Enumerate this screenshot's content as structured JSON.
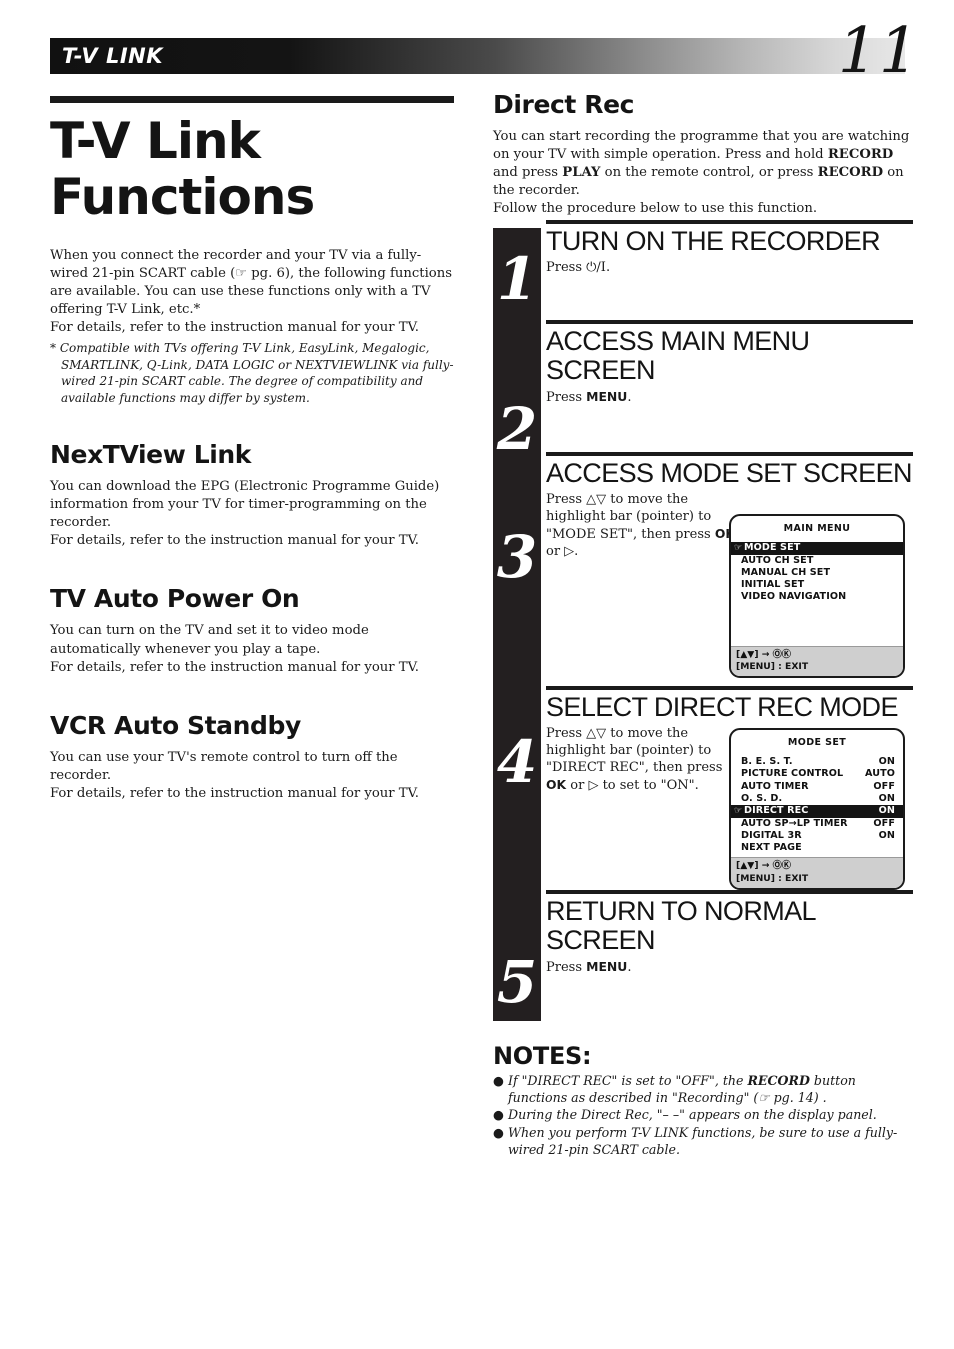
{
  "header": {
    "running_title": "T-V LINK",
    "page_number": "11"
  },
  "left_column": {
    "main_title_line1": "T-V Link",
    "main_title_line2": "Functions",
    "intro": "When you connect the recorder and your TV via a fully-wired 21-pin SCART cable (☞ pg. 6), the following functions are available. You can use these functions only with a TV offering T-V Link, etc.*",
    "intro_details": "For details, refer to the instruction manual for your TV.",
    "footnote": "* Compatible with TVs offering T-V Link, EasyLink, Megalogic, SMARTLINK, Q-Link, DATA LOGIC or NEXTVIEWLINK via fully-wired 21-pin SCART cable. The degree of compatibility and available functions may differ by system.",
    "sections": [
      {
        "heading": "NexTView Link",
        "body": "You can download the EPG (Electronic Programme Guide) information from your TV for timer-programming on the recorder.",
        "details": "For details, refer to the instruction manual for your TV."
      },
      {
        "heading": "TV Auto Power On",
        "body": "You can turn on the TV and set it to video mode automatically whenever you play a tape.",
        "details": "For details, refer to the instruction manual for your TV."
      },
      {
        "heading": "VCR Auto Standby",
        "body": "You can use your TV's remote control to turn off the recorder.",
        "details": "For details, refer to the instruction manual for your TV."
      }
    ]
  },
  "right_column": {
    "heading": "Direct Rec",
    "intro_part1": "You can start recording the programme that you are watching on your TV with simple operation. Press and hold ",
    "intro_record1": "RECORD",
    "intro_part2": " and press ",
    "intro_play": "PLAY",
    "intro_part3": " on the remote control, or press ",
    "intro_record2": "RECORD",
    "intro_part4": " on the recorder.",
    "intro_follow": "Follow the procedure below to use this function."
  },
  "steps": [
    {
      "number": "1",
      "title": "TURN ON THE RECORDER",
      "desc_prefix": "Press ",
      "desc_symbol": "⏻/I",
      "desc_suffix": "."
    },
    {
      "number": "2",
      "title": "ACCESS MAIN MENU SCREEN",
      "desc_prefix": "Press ",
      "desc_bold": "MENU",
      "desc_suffix": "."
    },
    {
      "number": "3",
      "title": "ACCESS MODE SET SCREEN",
      "desc_line1": "Press △▽ to move the highlight bar (pointer) to \"MODE SET\", then press ",
      "desc_bold": "OK",
      "desc_line2": " or ▷."
    },
    {
      "number": "4",
      "title": "SELECT DIRECT REC MODE",
      "desc_line1": "Press △▽ to move the highlight bar (pointer) to \"DIRECT REC\", then press ",
      "desc_bold": "OK",
      "desc_line2": " or ▷ to set to \"ON\"."
    },
    {
      "number": "5",
      "title": "RETURN TO NORMAL SCREEN",
      "desc_prefix": "Press ",
      "desc_bold": "MENU",
      "desc_suffix": "."
    }
  ],
  "osd_main_menu": {
    "title": "MAIN MENU",
    "rows": [
      {
        "label": "MODE SET",
        "value": "",
        "highlighted": true
      },
      {
        "label": "AUTO CH SET",
        "value": "",
        "highlighted": false
      },
      {
        "label": "MANUAL CH SET",
        "value": "",
        "highlighted": false
      },
      {
        "label": "INITIAL SET",
        "value": "",
        "highlighted": false
      },
      {
        "label": "VIDEO NAVIGATION",
        "value": "",
        "highlighted": false
      }
    ],
    "footer_line1": "[▲▼] → ⓄⓀ",
    "footer_line2": "[MENU] : EXIT"
  },
  "osd_mode_set": {
    "title": "MODE SET",
    "rows": [
      {
        "label": "B. E. S. T.",
        "value": "ON",
        "highlighted": false
      },
      {
        "label": "PICTURE CONTROL",
        "value": "AUTO",
        "highlighted": false
      },
      {
        "label": "AUTO TIMER",
        "value": "OFF",
        "highlighted": false
      },
      {
        "label": "O. S. D.",
        "value": "ON",
        "highlighted": false
      },
      {
        "label": "DIRECT REC",
        "value": "ON",
        "highlighted": true
      },
      {
        "label": "AUTO SP→LP TIMER",
        "value": "OFF",
        "highlighted": false
      },
      {
        "label": "DIGITAL 3R",
        "value": "ON",
        "highlighted": false
      },
      {
        "label": "NEXT PAGE",
        "value": "",
        "highlighted": false
      }
    ],
    "footer_line1": "[▲▼] → ⓄⓀ",
    "footer_line2": "[MENU] : EXIT"
  },
  "notes": {
    "title": "NOTES:",
    "items": [
      {
        "part1": "If \"DIRECT REC\" is set to \"OFF\", the ",
        "bold": "RECORD",
        "part2": " button functions as described in \"Recording\" (☞ pg. 14) ."
      },
      {
        "part1": "During the Direct Rec, \"– –\" appears on the display panel.",
        "bold": "",
        "part2": ""
      },
      {
        "part1": "When you perform T-V LINK functions, be sure to use a fully-wired 21-pin SCART cable.",
        "bold": "",
        "part2": ""
      }
    ]
  }
}
